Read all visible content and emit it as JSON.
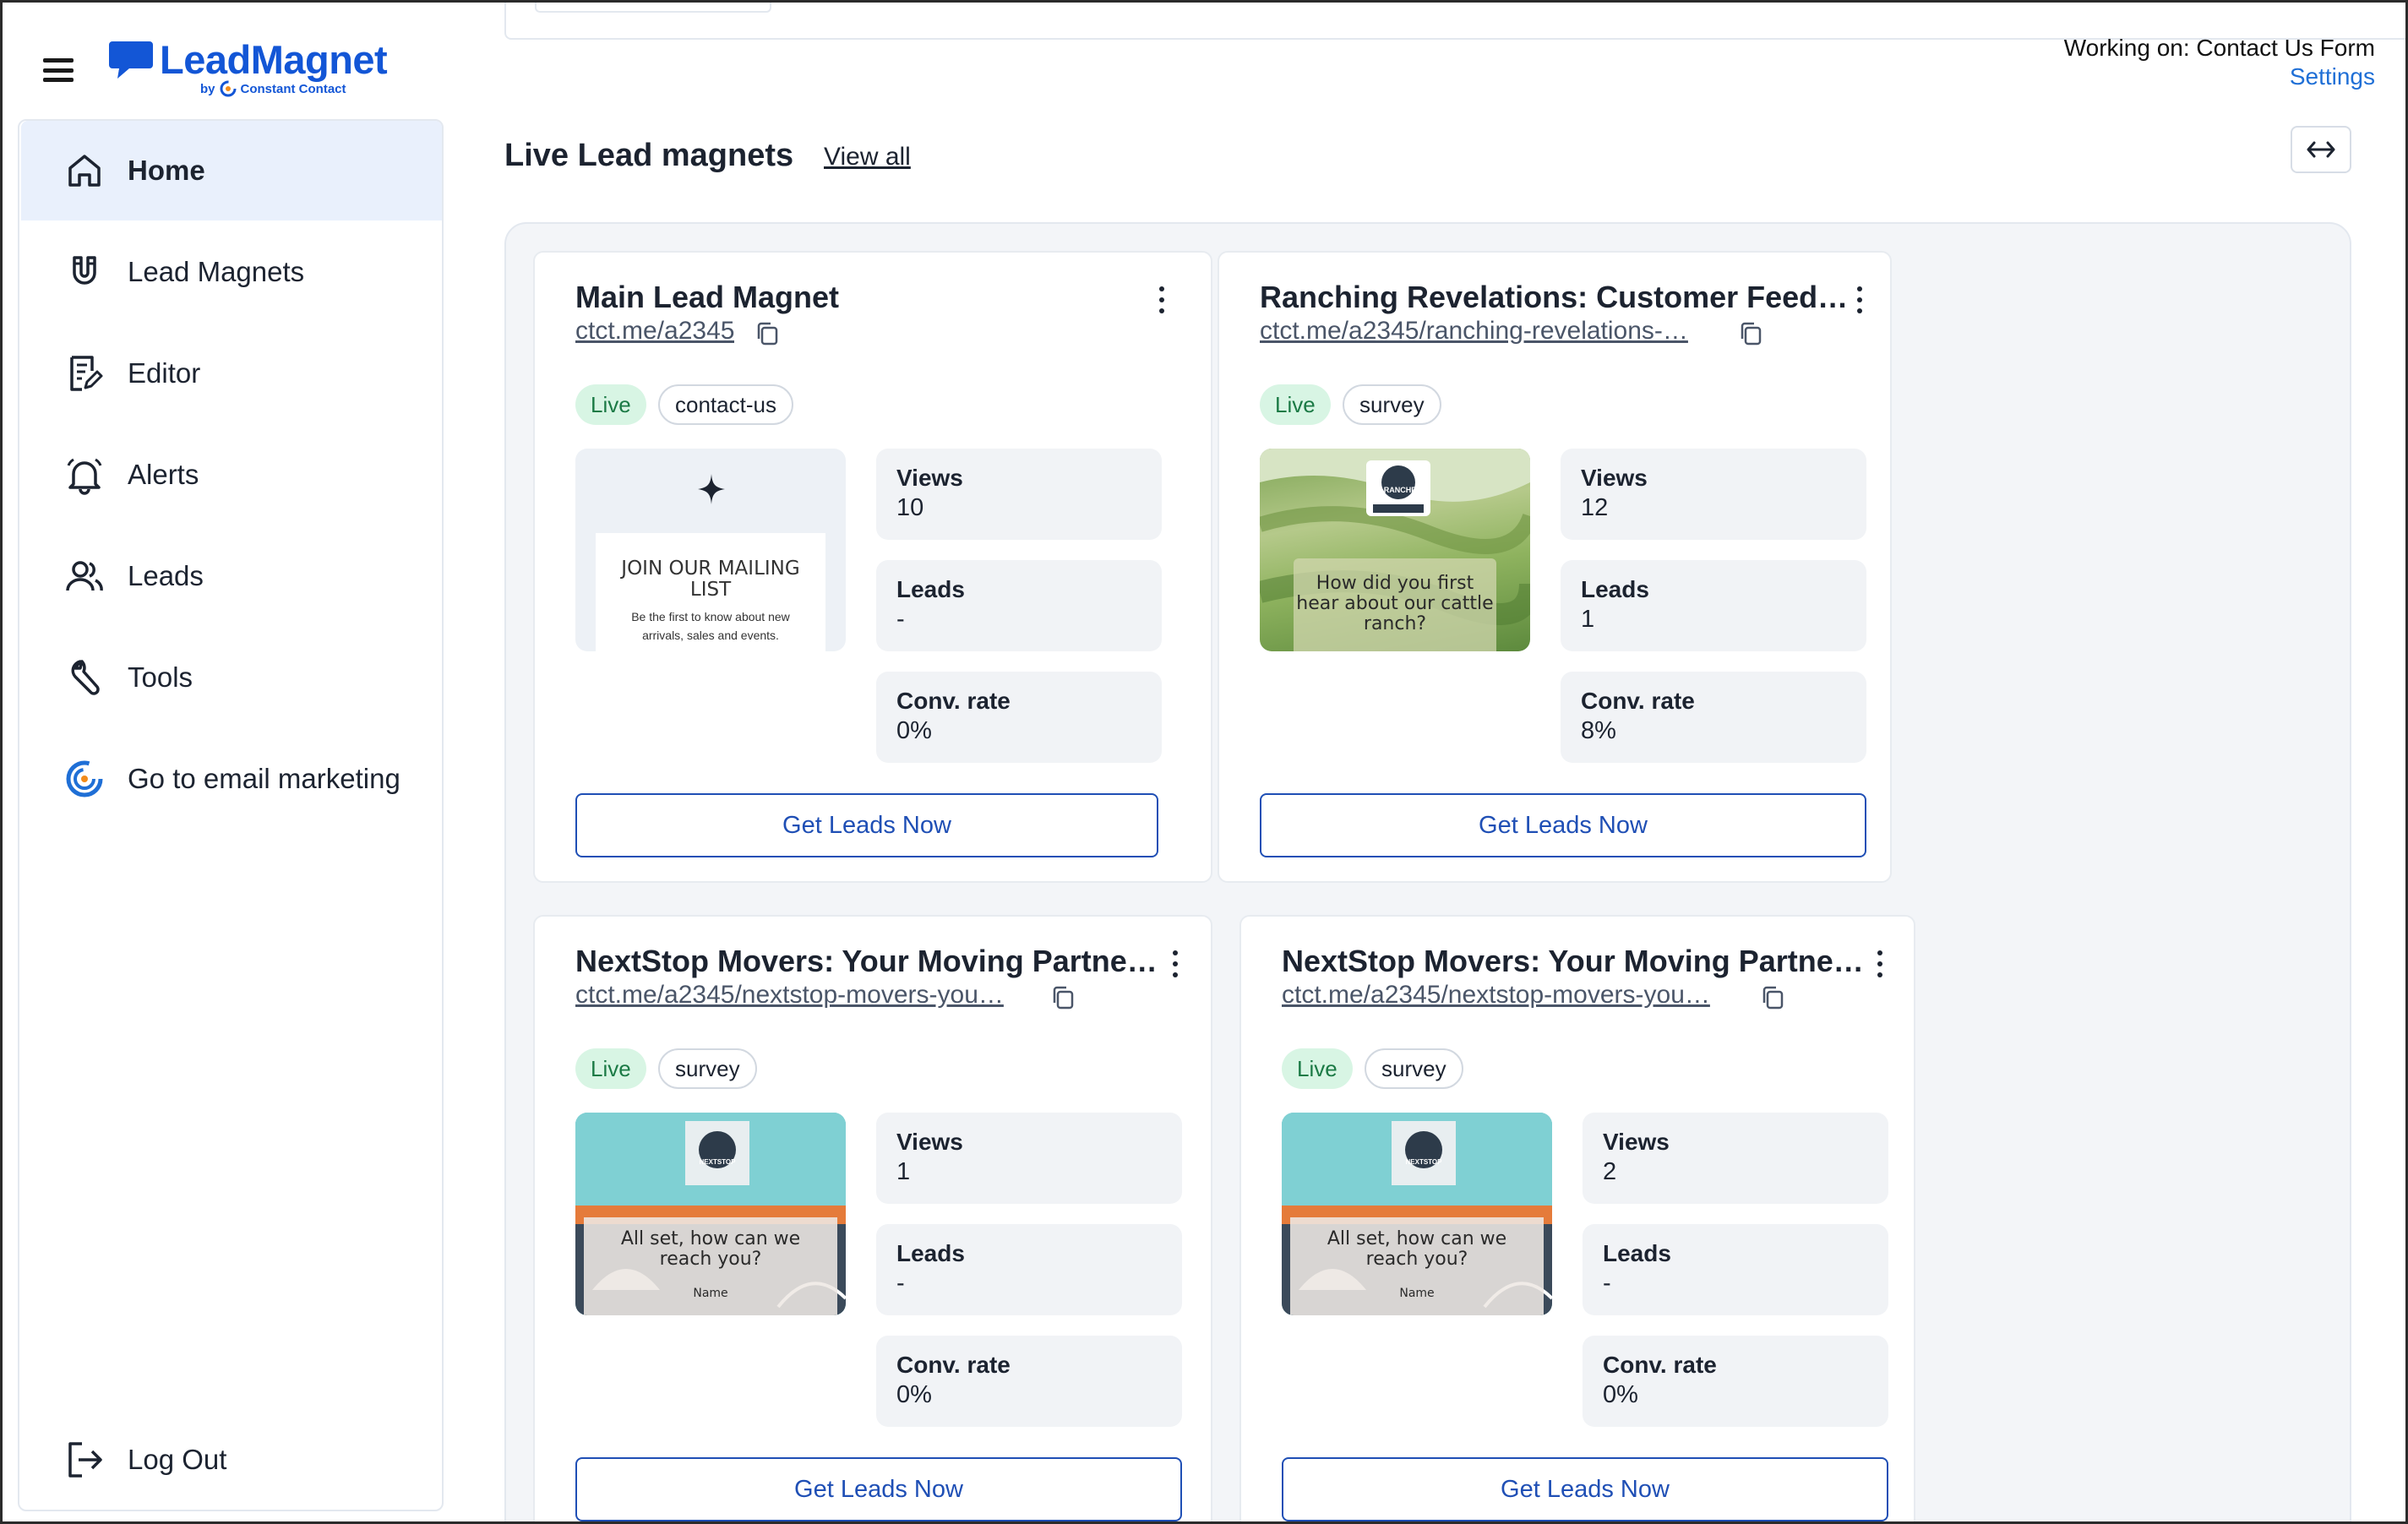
{
  "app": {
    "brand_name": "LeadMagnet",
    "brand_by": "by",
    "brand_partner": "Constant Contact",
    "working_on": "Working on: Contact Us Form",
    "settings_label": "Settings"
  },
  "sidebar": {
    "items": [
      {
        "label": "Home",
        "icon": "home-icon",
        "active": true
      },
      {
        "label": "Lead Magnets",
        "icon": "magnet-icon"
      },
      {
        "label": "Editor",
        "icon": "editor-icon"
      },
      {
        "label": "Alerts",
        "icon": "bell-icon"
      },
      {
        "label": "Leads",
        "icon": "users-icon"
      },
      {
        "label": "Tools",
        "icon": "wrench-icon"
      },
      {
        "label": "Go to email marketing",
        "icon": "constant-contact-icon"
      }
    ],
    "logout_label": "Log Out"
  },
  "main": {
    "section_title": "Live Lead magnets",
    "view_all_label": "View all",
    "expand_icon": "expand-arrows-icon",
    "cards": [
      {
        "title": "Main Lead Magnet",
        "link": "ctct.me/a2345",
        "status": "Live",
        "type": "contact-us",
        "thumb_heading": "JOIN OUR MAILING LIST",
        "thumb_sub": "Be the first to know about new arrivals, sales and events.",
        "views_label": "Views",
        "views": "10",
        "leads_label": "Leads",
        "leads": "-",
        "conv_label": "Conv. rate",
        "conv": "0%",
        "cta": "Get Leads Now"
      },
      {
        "title": "Ranching Revelations: Customer Feed…",
        "link": "ctct.me/a2345/ranching-revelations-…",
        "status": "Live",
        "type": "survey",
        "thumb_text": "How did you first hear about our cattle ranch?",
        "thumb_logo": "RANCHE",
        "views_label": "Views",
        "views": "12",
        "leads_label": "Leads",
        "leads": "1",
        "conv_label": "Conv. rate",
        "conv": "8%",
        "cta": "Get Leads Now"
      },
      {
        "title": "NextStop Movers: Your Moving Partne…",
        "link": "ctct.me/a2345/nextstop-movers-you…",
        "status": "Live",
        "type": "survey",
        "thumb_text": "All set, how can we reach you?",
        "thumb_field": "Name",
        "thumb_logo": "NEXTSTOP",
        "views_label": "Views",
        "views": "1",
        "leads_label": "Leads",
        "leads": "-",
        "conv_label": "Conv. rate",
        "conv": "0%",
        "cta": "Get Leads Now"
      },
      {
        "title": "NextStop Movers: Your Moving Partne…",
        "link": "ctct.me/a2345/nextstop-movers-you…",
        "status": "Live",
        "type": "survey",
        "thumb_text": "All set, how can we reach you?",
        "thumb_field": "Name",
        "thumb_logo": "NEXTSTOP",
        "views_label": "Views",
        "views": "2",
        "leads_label": "Leads",
        "leads": "-",
        "conv_label": "Conv. rate",
        "conv": "0%",
        "cta": "Get Leads Now"
      }
    ]
  },
  "colors": {
    "brand": "#1356d6",
    "accent_link": "#1f6fd6",
    "cta_border": "#1f4fb5",
    "live_badge_bg": "#d8f5e4",
    "live_badge_text": "#1b7a45",
    "active_nav_bg": "#e9f0fc"
  }
}
